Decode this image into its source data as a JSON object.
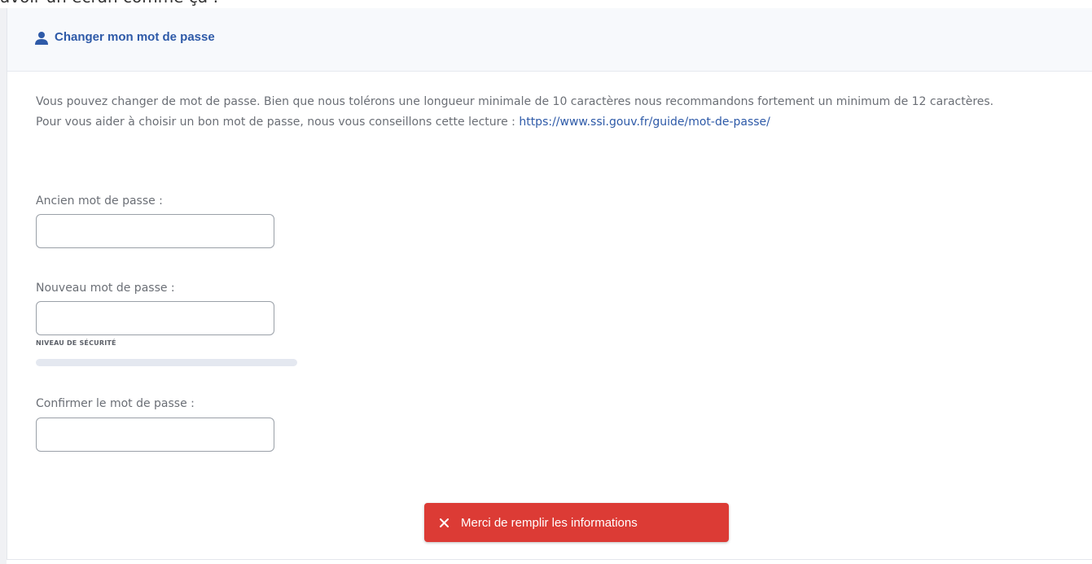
{
  "page": {
    "top_partial_text": "avoir un écran comme ça :"
  },
  "card": {
    "title": "Changer mon mot de passe",
    "title_icon": "user-icon",
    "intro_line_1": "Vous pouvez changer de mot de passe. Bien que nous tolérons une longueur minimale de 10 caractères nous recommandons fortement un minimum de 12 caractères.",
    "intro_line_2_prefix": "Pour vous aider à choisir un bon mot de passe, nous vous conseillons cette lecture : ",
    "intro_link": "https://www.ssi.gouv.fr/guide/mot-de-passe/"
  },
  "form": {
    "old_password": {
      "label": "Ancien mot de passe :",
      "value": "",
      "placeholder": ""
    },
    "new_password": {
      "label": "Nouveau mot de passe :",
      "value": "",
      "placeholder": ""
    },
    "strength": {
      "label": "NIVEAU DE SÉCURITÉ",
      "level_percent": 0
    },
    "confirm_password": {
      "label": "Confirmer le mot de passe :",
      "value": "",
      "placeholder": ""
    }
  },
  "alert": {
    "label": "Merci de remplir les informations",
    "icon": "close-icon"
  },
  "colors": {
    "accent": "#2e5aa8",
    "danger": "#dc3b35",
    "text_muted": "#6b6f76",
    "header_bg": "#f7f9fc"
  }
}
